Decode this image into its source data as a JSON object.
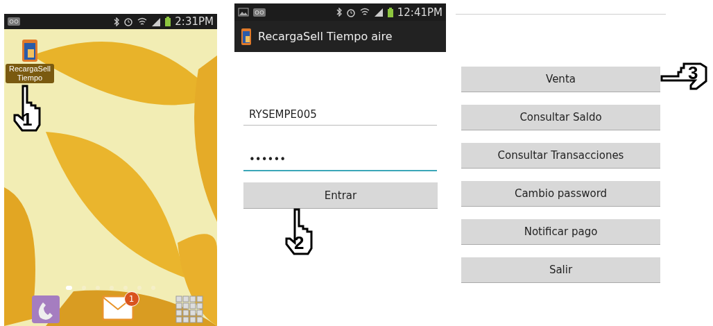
{
  "screens": [
    {
      "kind": "home",
      "status_bar": {
        "notifications": [
          {
            "kind": "voicemail"
          }
        ],
        "time": "2:31PM"
      },
      "app_icon": {
        "label": "RecargaSell Tiempo"
      },
      "page_dots": [
        {
          "selected": true
        },
        {
          "selected": false
        },
        {
          "selected": false
        },
        {
          "selected": false
        },
        {
          "selected": false
        },
        {
          "selected": false
        },
        {
          "selected": false
        }
      ],
      "dock": [
        {
          "kind": "phone"
        },
        {
          "kind": "mail",
          "badge": "1"
        },
        {
          "kind": "apps"
        }
      ],
      "pointer": {
        "number": "1",
        "kind": "up"
      }
    },
    {
      "kind": "login",
      "status_bar": {
        "notifications": [
          {
            "kind": "image"
          },
          {
            "kind": "voicemail"
          }
        ],
        "time": "12:41PM"
      },
      "title": "RecargaSell Tiempo aire",
      "fields": [
        {
          "value": "RYSEMPE005",
          "focused": false
        },
        {
          "value": "••••••",
          "focused": true
        }
      ],
      "button": "Entrar",
      "pointer": {
        "number": "2",
        "kind": "up"
      }
    },
    {
      "kind": "menu",
      "buttons": [
        "Venta",
        "Consultar Saldo",
        "Consultar Transacciones",
        "Cambio password",
        "Notificar pago",
        "Salir"
      ],
      "pointer": {
        "number": "3",
        "kind": "left"
      }
    }
  ]
}
